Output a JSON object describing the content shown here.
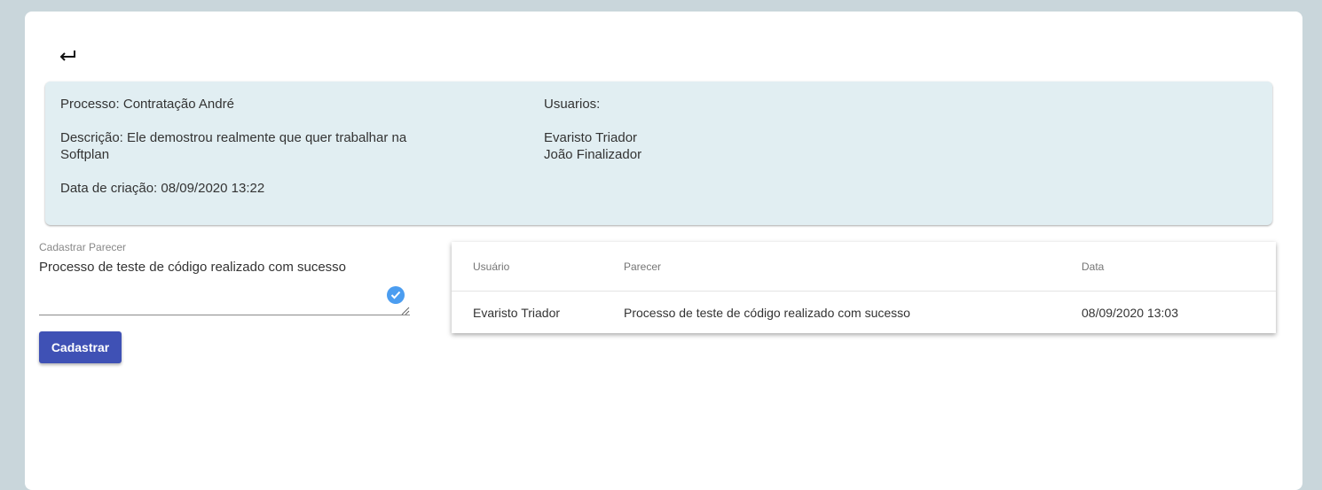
{
  "back": {
    "icon": "return-arrow-icon"
  },
  "process": {
    "name_line": "Processo: Contratação André",
    "description_line1": "Descrição: Ele demostrou realmente que quer trabalhar na",
    "description_line2": "Softplan",
    "created_line": "Data de criação: 08/09/2020 13:22"
  },
  "users": {
    "title": "Usuarios:",
    "items": [
      "Evaristo Triador",
      "João Finalizador"
    ]
  },
  "form": {
    "label": "Cadastrar Parecer",
    "value": "Processo de teste de código realizado com sucesso",
    "submit_label": "Cadastrar",
    "accent": "#3f51b5",
    "check_color": "#4b9df0"
  },
  "table": {
    "headers": [
      "Usuário",
      "Parecer",
      "Data"
    ],
    "rows": [
      [
        "Evaristo Triador",
        "Processo de teste de código realizado com sucesso",
        "08/09/2020 13:03"
      ]
    ]
  }
}
